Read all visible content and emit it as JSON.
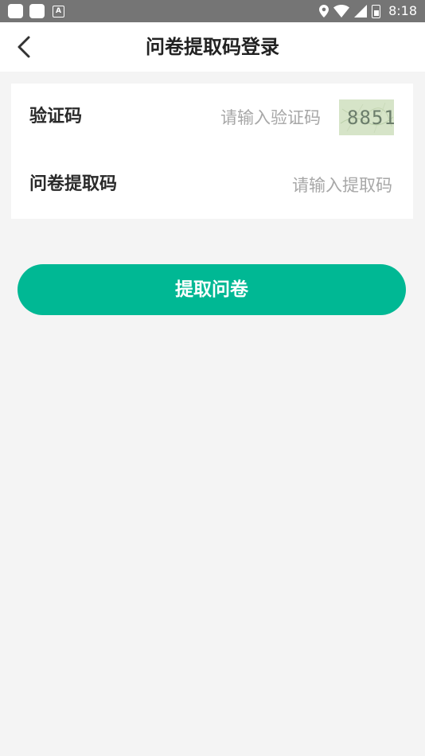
{
  "status_bar": {
    "time": "8:18",
    "notification_icons": [
      "app-icon",
      "app-icon",
      "a-icon"
    ],
    "system_icons": [
      "location-icon",
      "wifi-icon",
      "signal-icon",
      "battery-icon"
    ]
  },
  "header": {
    "title": "问卷提取码登录",
    "back_icon": "chevron-left-icon"
  },
  "form": {
    "captcha_row": {
      "label": "验证码",
      "placeholder": "请输入验证码",
      "captcha_image_text": "8851"
    },
    "code_row": {
      "label": "问卷提取码",
      "placeholder": "请输入提取码"
    }
  },
  "submit": {
    "label": "提取问卷"
  },
  "colors": {
    "accent": "#00b894",
    "background": "#f4f4f4",
    "status_bar": "#757575",
    "captcha_bg": "#d6e4c8"
  }
}
